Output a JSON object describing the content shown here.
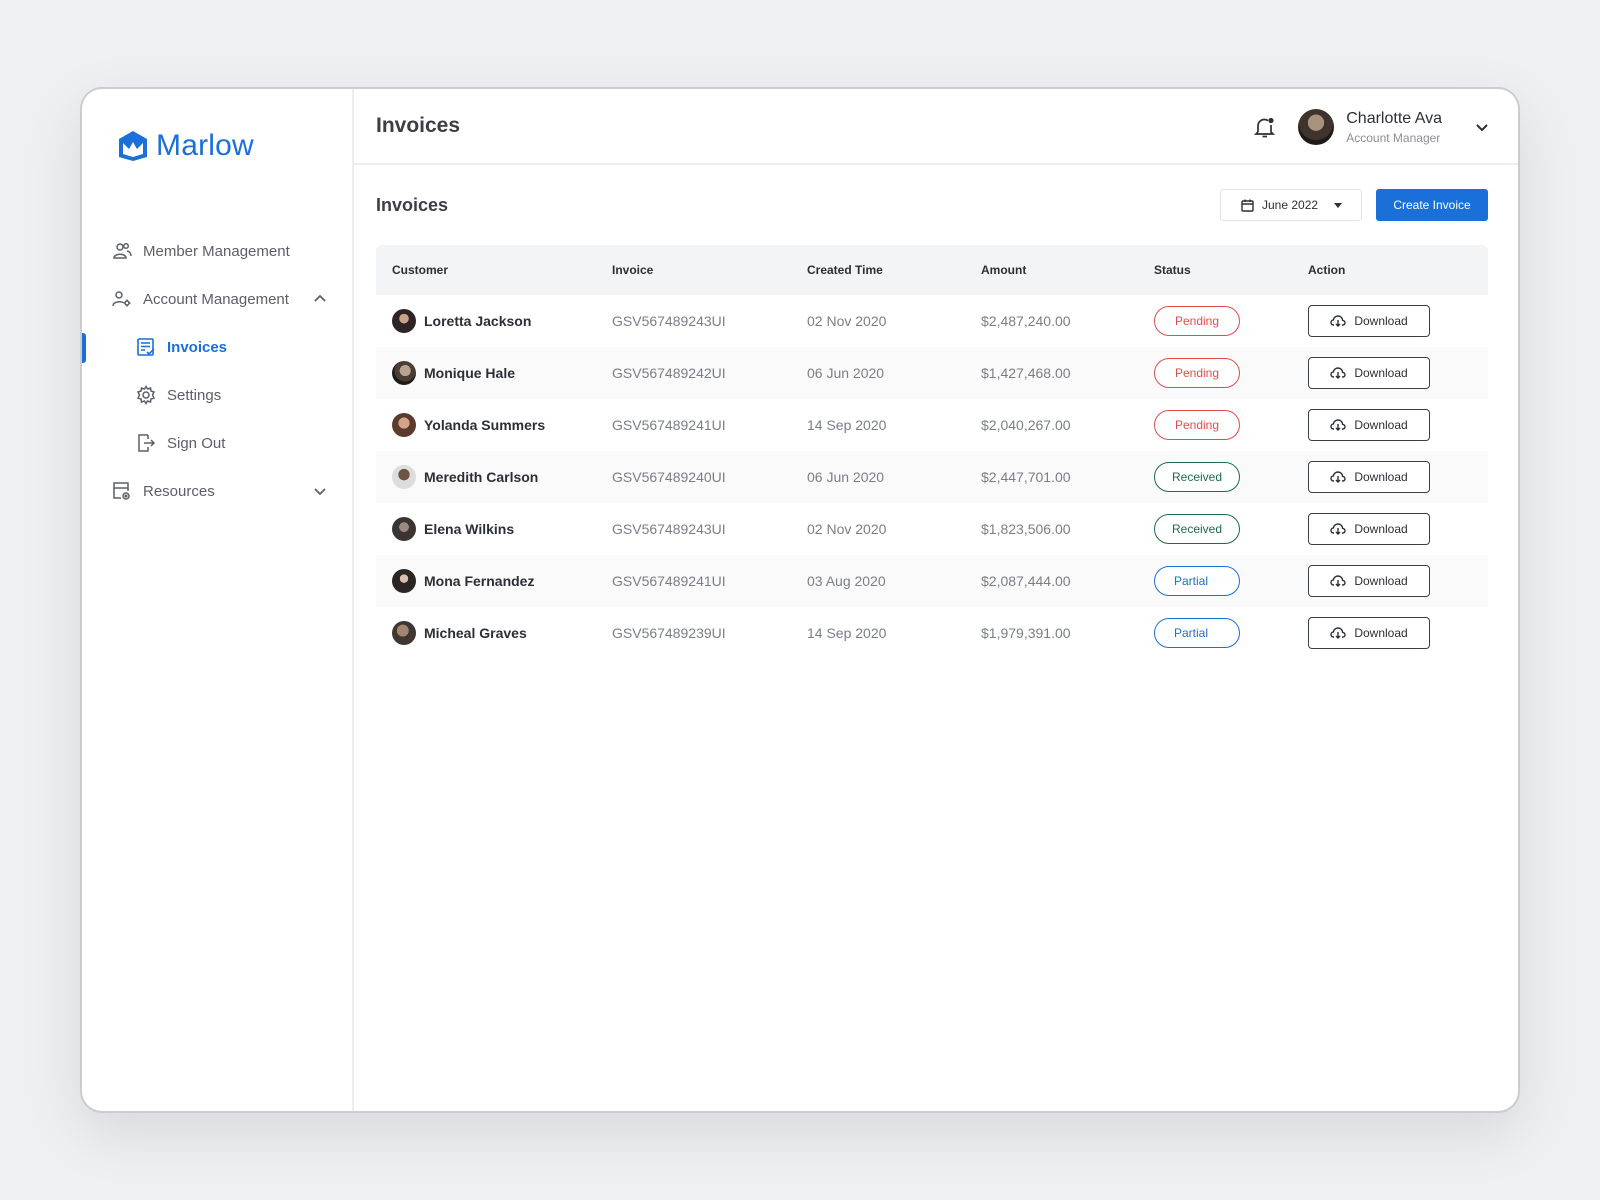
{
  "brand": {
    "name": "Marlow",
    "color": "#1a6fd9"
  },
  "sidebar": {
    "items": [
      {
        "label": "Member Management",
        "icon": "users-icon"
      },
      {
        "label": "Account Management",
        "icon": "user-gear-icon"
      },
      {
        "label": "Invoices",
        "icon": "invoice-icon",
        "active": true
      },
      {
        "label": "Settings",
        "icon": "gear-icon"
      },
      {
        "label": "Sign Out",
        "icon": "sign-out-icon"
      },
      {
        "label": "Resources",
        "icon": "resources-icon"
      }
    ]
  },
  "header": {
    "title": "Invoices",
    "user": {
      "name": "Charlotte Ava",
      "role": "Account Manager"
    }
  },
  "main": {
    "section_title": "Invoices",
    "date_filter": "June 2022",
    "create_label": "Create Invoice",
    "table": {
      "columns": [
        "Customer",
        "Invoice",
        "Created Time",
        "Amount",
        "Status",
        "Action"
      ],
      "rows": [
        {
          "customer": "Loretta Jackson",
          "invoice": "GSV567489243UI",
          "created": "02 Nov 2020",
          "amount": "$2,487,240.00",
          "status": "Pending",
          "action": "Download"
        },
        {
          "customer": "Monique Hale",
          "invoice": "GSV567489242UI",
          "created": "06 Jun 2020",
          "amount": "$1,427,468.00",
          "status": "Pending",
          "action": "Download"
        },
        {
          "customer": "Yolanda Summers",
          "invoice": "GSV567489241UI",
          "created": "14 Sep 2020",
          "amount": "$2,040,267.00",
          "status": "Pending",
          "action": "Download"
        },
        {
          "customer": "Meredith Carlson",
          "invoice": "GSV567489240UI",
          "created": "06 Jun 2020",
          "amount": "$2,447,701.00",
          "status": "Received",
          "action": "Download"
        },
        {
          "customer": "Elena Wilkins",
          "invoice": "GSV567489243UI",
          "created": "02 Nov 2020",
          "amount": "$1,823,506.00",
          "status": "Received",
          "action": "Download"
        },
        {
          "customer": "Mona Fernandez",
          "invoice": "GSV567489241UI",
          "created": "03 Aug 2020",
          "amount": "$2,087,444.00",
          "status": "Partial",
          "action": "Download"
        },
        {
          "customer": "Micheal Graves",
          "invoice": "GSV567489239UI",
          "created": "14 Sep 2020",
          "amount": "$1,979,391.00",
          "status": "Partial",
          "action": "Download"
        }
      ]
    }
  },
  "colors": {
    "accent": "#1a6fd9",
    "pending": "#e14c4c",
    "received": "#1f6b4a",
    "partial": "#1a6fd9"
  }
}
